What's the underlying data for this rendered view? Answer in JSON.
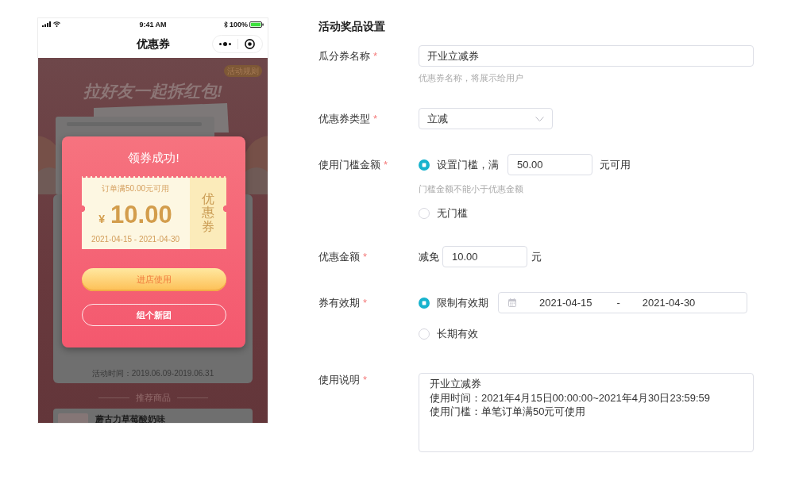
{
  "phone": {
    "status_bar": {
      "time": "9:41 AM",
      "battery": "100%"
    },
    "nav_bar": {
      "title": "优惠券"
    },
    "page": {
      "rules_badge": "活动规则",
      "headline": "拉好友一起拆红包!",
      "activity_time": "活动时间：2019.06.09-2019.06.31",
      "section_title": "推荐商品",
      "products": [
        {
          "name": "蘑古力草莓酸奶味"
        }
      ]
    },
    "modal": {
      "title": "领券成功!",
      "coupon": {
        "condition": "订单满50.00元可用",
        "currency": "¥",
        "amount": "10.00",
        "validity": "2021-04-15 - 2021-04-30",
        "stub_label": "优惠券"
      },
      "buttons": [
        {
          "label": "进店使用",
          "kind": "primary"
        },
        {
          "label": "组个新团",
          "kind": "outline"
        }
      ]
    }
  },
  "form": {
    "title": "活动奖品设置",
    "fields": [
      {
        "kind": "text",
        "label": "瓜分券名称",
        "required_mark": "*",
        "value": "开业立减券",
        "hint": "优惠券名称，将展示给用户"
      },
      {
        "kind": "select",
        "label": "优惠券类型",
        "required_mark": "*",
        "value": "立减"
      },
      {
        "kind": "radio",
        "label": "使用门槛金额",
        "required_mark": "*",
        "options": [
          {
            "kind": "amount",
            "label": "设置门槛，满",
            "selected": true,
            "value": "50.00",
            "suffix": "元可用",
            "hint": "门槛金额不能小于优惠金额"
          },
          {
            "kind": "plain",
            "label": "无门槛",
            "selected": false
          }
        ]
      },
      {
        "kind": "amount",
        "label": "优惠金额",
        "required_mark": "*",
        "prefix": "减免",
        "value": "10.00",
        "suffix": "元"
      },
      {
        "kind": "radio",
        "label": "券有效期",
        "required_mark": "*",
        "options": [
          {
            "kind": "date_range",
            "label": "限制有效期",
            "selected": true,
            "start": "2021-04-15",
            "separator": "-",
            "end": "2021-04-30"
          },
          {
            "kind": "plain",
            "label": "长期有效",
            "selected": false
          }
        ]
      },
      {
        "kind": "textarea",
        "label": "使用说明",
        "required_mark": "*",
        "lines": [
          "开业立减券",
          "使用时间：2021年4月15日00:00:00~2021年4月30日23:59:59",
          "使用门槛：单笔订单满50元可使用"
        ]
      }
    ]
  }
}
